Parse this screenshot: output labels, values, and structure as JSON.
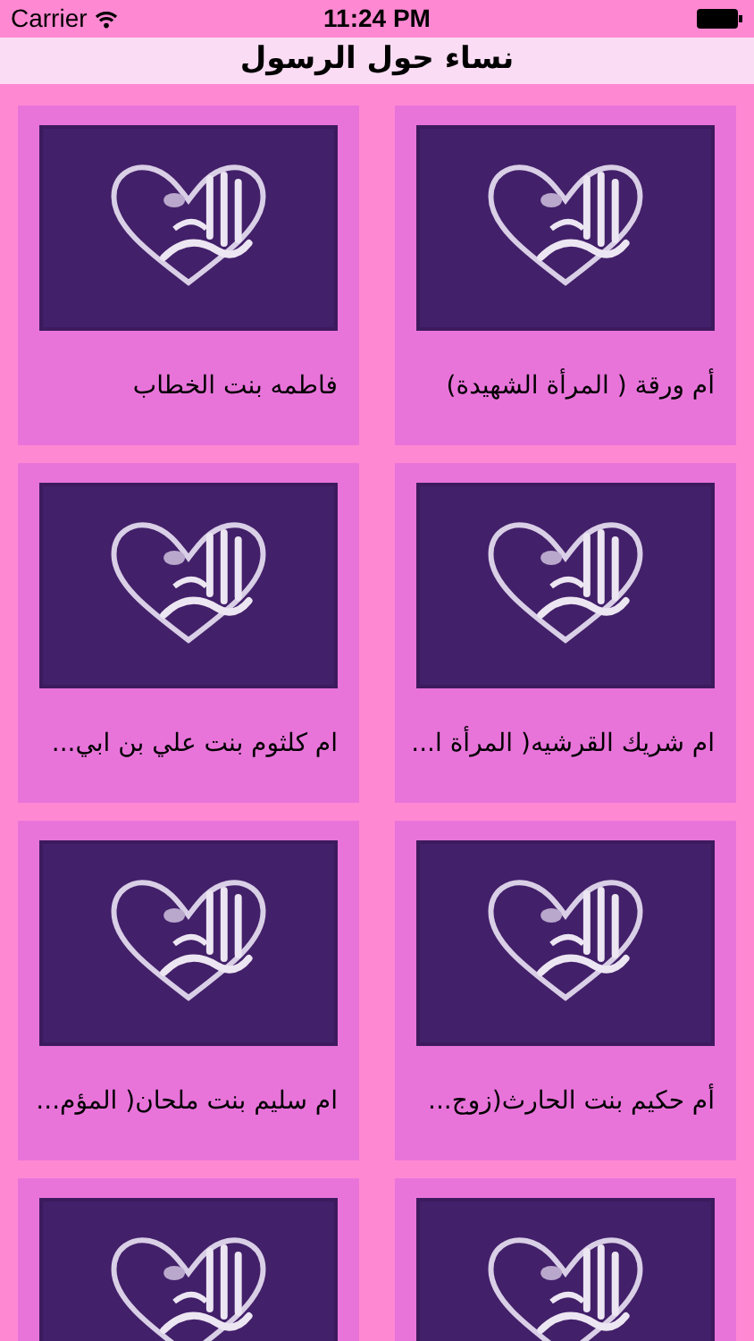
{
  "status_bar": {
    "carrier": "Carrier",
    "time": "11:24 PM"
  },
  "nav_bar": {
    "title": "نساء حول الرسول"
  },
  "cards": [
    {
      "kind": "picture",
      "title": "أم ورقة ( المرأة الشهيدة)"
    },
    {
      "kind": "picture",
      "title": "فاطمه بنت الخطاب"
    },
    {
      "kind": "picture",
      "title": "ام شريك القرشيه( المرأة ا..."
    },
    {
      "kind": "picture",
      "title": "ام كلثوم بنت علي بن ابي..."
    },
    {
      "kind": "picture",
      "title": "أم حكيم بنت الحارث(زوج..."
    },
    {
      "kind": "picture",
      "title": "ام سليم بنت ملحان( المؤم..."
    },
    {
      "kind": "picture"
    },
    {
      "kind": "picture"
    }
  ]
}
